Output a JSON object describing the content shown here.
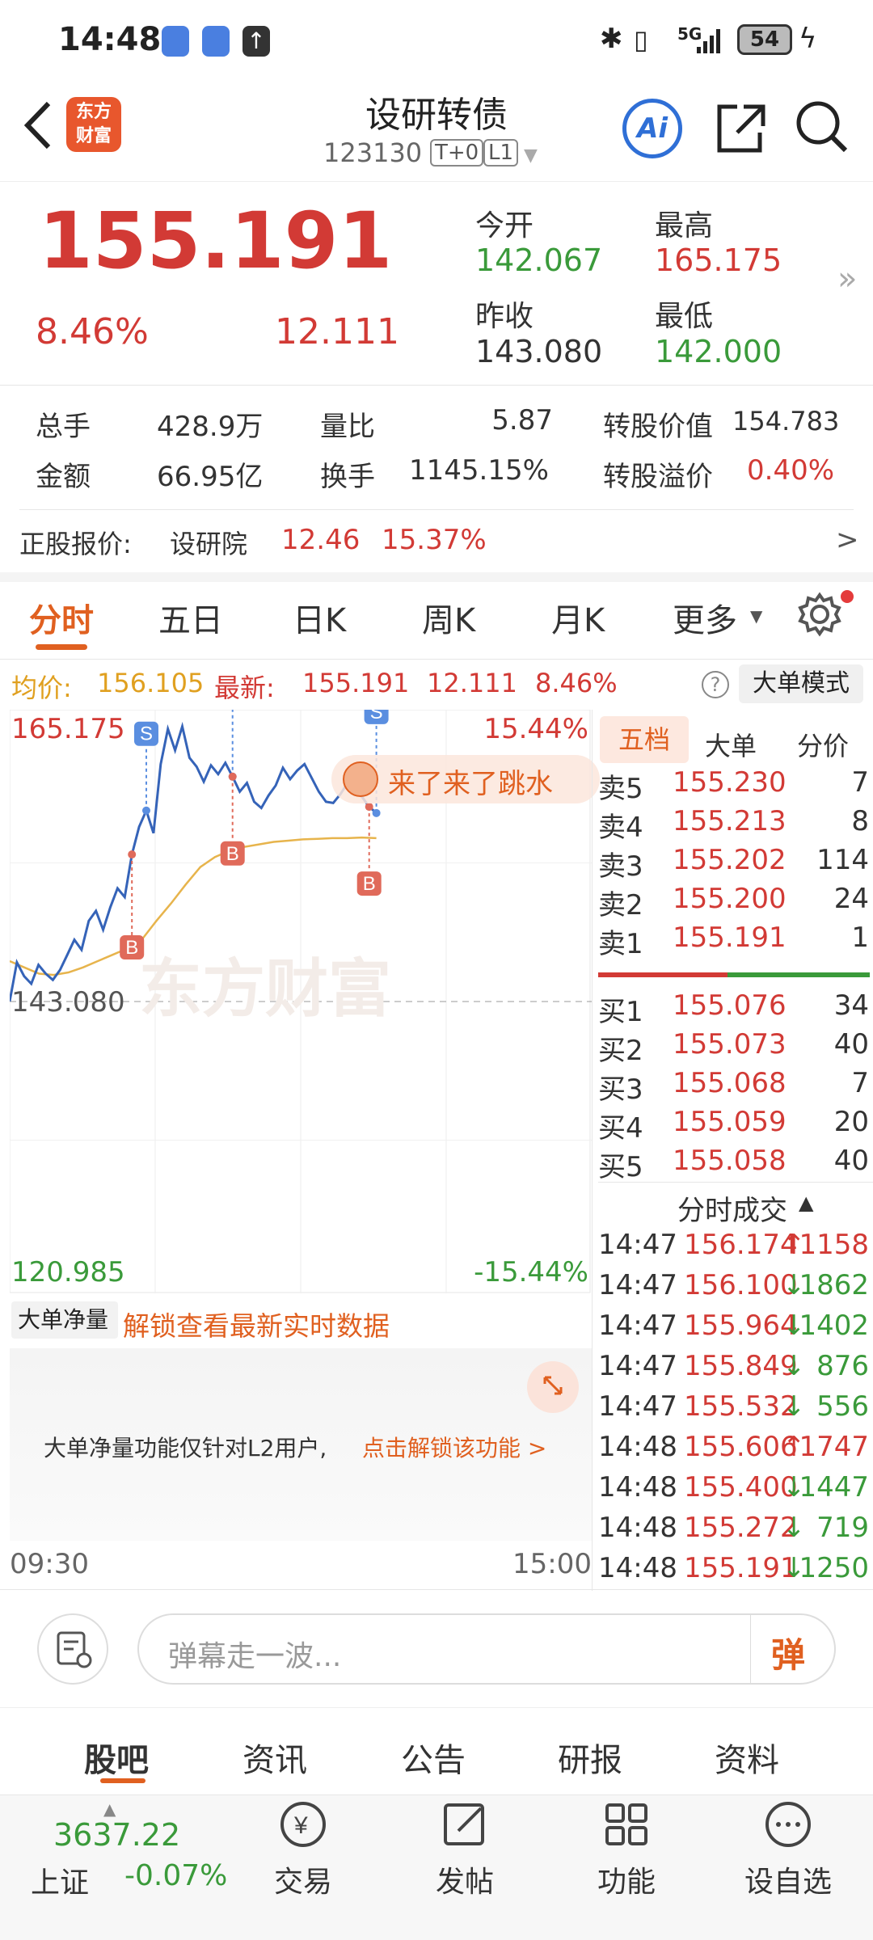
{
  "status_bar": {
    "time": "14:48",
    "network": "5G",
    "battery": "54"
  },
  "header": {
    "title": "设研转债",
    "code": "123130",
    "badge_t0": "T+0",
    "badge_l1": "L1",
    "logo_line1": "东方",
    "logo_line2": "财富",
    "ai_label": "Ai"
  },
  "quote": {
    "price": "155.191",
    "change_pct": "8.46%",
    "change": "12.111",
    "open_label": "今开",
    "open": "142.067",
    "high_label": "最高",
    "high": "165.175",
    "prev_close_label": "昨收",
    "prev_close": "143.080",
    "low_label": "最低",
    "low": "142.000"
  },
  "stats": {
    "volume_label": "总手",
    "volume": "428.9万",
    "ratio_label": "量比",
    "ratio": "5.87",
    "conv_value_label": "转股价值",
    "conv_value": "154.783",
    "amount_label": "金额",
    "amount": "66.95亿",
    "turnover_label": "换手",
    "turnover": "1145.15%",
    "conv_premium_label": "转股溢价",
    "conv_premium": "0.40%"
  },
  "underlying": {
    "label": "正股报价:",
    "name": "设研院",
    "price": "12.46",
    "change_pct": "15.37%",
    "arrow": ">"
  },
  "chart_tabs": [
    {
      "label": "分时"
    },
    {
      "label": "五日"
    },
    {
      "label": "日K"
    },
    {
      "label": "周K"
    },
    {
      "label": "月K"
    },
    {
      "label": "更多"
    }
  ],
  "chart_info": {
    "avg_label": "均价:",
    "avg": "156.105",
    "latest_label": "最新:",
    "latest": "155.191",
    "change": "12.111",
    "change_pct": "8.46%",
    "mode_button": "大单模式"
  },
  "chart_labels": {
    "top_price": "165.175",
    "top_pct": "15.44%",
    "mid_price": "143.080",
    "bottom_price": "120.985",
    "bottom_pct": "-15.44%",
    "time_start": "09:30",
    "time_end": "15:00",
    "bubble_text": "来了来了跳水",
    "watermark": "东方财富",
    "s_marker": "S",
    "b_marker": "B"
  },
  "net_volume": {
    "dropdown": "大单净量",
    "unlock_hint": "解锁查看最新实时数据",
    "notice": "大单净量功能仅针对L2用户,",
    "notice_link": "点击解锁该功能 >"
  },
  "orderbook_tabs": [
    {
      "label": "五档"
    },
    {
      "label": "大单"
    },
    {
      "label": "分价"
    }
  ],
  "orderbook": {
    "asks": [
      {
        "label": "卖5",
        "price": "155.230",
        "vol": "7"
      },
      {
        "label": "卖4",
        "price": "155.213",
        "vol": "8"
      },
      {
        "label": "卖3",
        "price": "155.202",
        "vol": "114"
      },
      {
        "label": "卖2",
        "price": "155.200",
        "vol": "24"
      },
      {
        "label": "卖1",
        "price": "155.191",
        "vol": "1"
      }
    ],
    "bids": [
      {
        "label": "买1",
        "price": "155.076",
        "vol": "34"
      },
      {
        "label": "买2",
        "price": "155.073",
        "vol": "40"
      },
      {
        "label": "买3",
        "price": "155.068",
        "vol": "7"
      },
      {
        "label": "买4",
        "price": "155.059",
        "vol": "20"
      },
      {
        "label": "买5",
        "price": "155.058",
        "vol": "40"
      }
    ]
  },
  "trades_title": "分时成交",
  "trades": [
    {
      "time": "14:47",
      "price": "156.174",
      "dir": "up",
      "vol": "1158"
    },
    {
      "time": "14:47",
      "price": "156.100",
      "dir": "down",
      "vol": "1862"
    },
    {
      "time": "14:47",
      "price": "155.964",
      "dir": "down",
      "vol": "1402"
    },
    {
      "time": "14:47",
      "price": "155.849",
      "dir": "down",
      "vol": "876"
    },
    {
      "time": "14:47",
      "price": "155.532",
      "dir": "down",
      "vol": "556"
    },
    {
      "time": "14:48",
      "price": "155.606",
      "dir": "up",
      "vol": "1747"
    },
    {
      "time": "14:48",
      "price": "155.400",
      "dir": "down",
      "vol": "1447"
    },
    {
      "time": "14:48",
      "price": "155.272",
      "dir": "down",
      "vol": "719"
    },
    {
      "time": "14:48",
      "price": "155.191",
      "dir": "down",
      "vol": "1250"
    }
  ],
  "danmaku": {
    "placeholder": "弹幕走一波...",
    "send_label": "弹"
  },
  "bottom_tabs": [
    {
      "label": "股吧"
    },
    {
      "label": "资讯"
    },
    {
      "label": "公告"
    },
    {
      "label": "研报"
    },
    {
      "label": "资料"
    }
  ],
  "index": {
    "value": "3637.22",
    "name": "上证",
    "change": "-0.07%"
  },
  "dock": [
    {
      "label": "交易"
    },
    {
      "label": "发帖"
    },
    {
      "label": "功能"
    },
    {
      "label": "设自选"
    }
  ],
  "colors": {
    "up": "#d23a35",
    "down": "#3a9a3a",
    "accent": "#e06020",
    "price_line": "#3563b8",
    "avg_line": "#e7b44c"
  },
  "chart_data": {
    "type": "line",
    "title": "",
    "x": [
      "09:30",
      "15:00"
    ],
    "y_range": [
      120.985,
      165.175
    ],
    "prev_close": 143.08,
    "series": [
      {
        "values": [
          143.1,
          146.2,
          145.1,
          144.5,
          146.0,
          145.3,
          144.8,
          145.6,
          146.8,
          148.0,
          147.2,
          149.5,
          150.3,
          148.8,
          150.6,
          152.1,
          151.4,
          154.8,
          157.0,
          158.3,
          156.5,
          162.0,
          164.8,
          163.1,
          165.0,
          162.5,
          161.8,
          160.6,
          161.9,
          161.2,
          162.1,
          161.0,
          159.8,
          160.5,
          159.0,
          158.5,
          159.5,
          160.3,
          161.7,
          160.8,
          161.5,
          162.0,
          160.9,
          159.8,
          159.0,
          158.9,
          159.6,
          160.5,
          159.8,
          159.4,
          158.6,
          158.1
        ]
      },
      {
        "values": [
          146.3,
          145.8,
          145.3,
          145.2,
          145.4,
          145.8,
          146.3,
          146.8,
          147.3,
          148.0,
          149.5,
          150.9,
          152.4,
          153.8,
          154.6,
          155.1,
          155.4,
          155.6,
          155.8,
          155.9,
          156.0,
          156.05,
          156.1,
          156.1,
          156.15,
          156.1
        ]
      }
    ]
  }
}
